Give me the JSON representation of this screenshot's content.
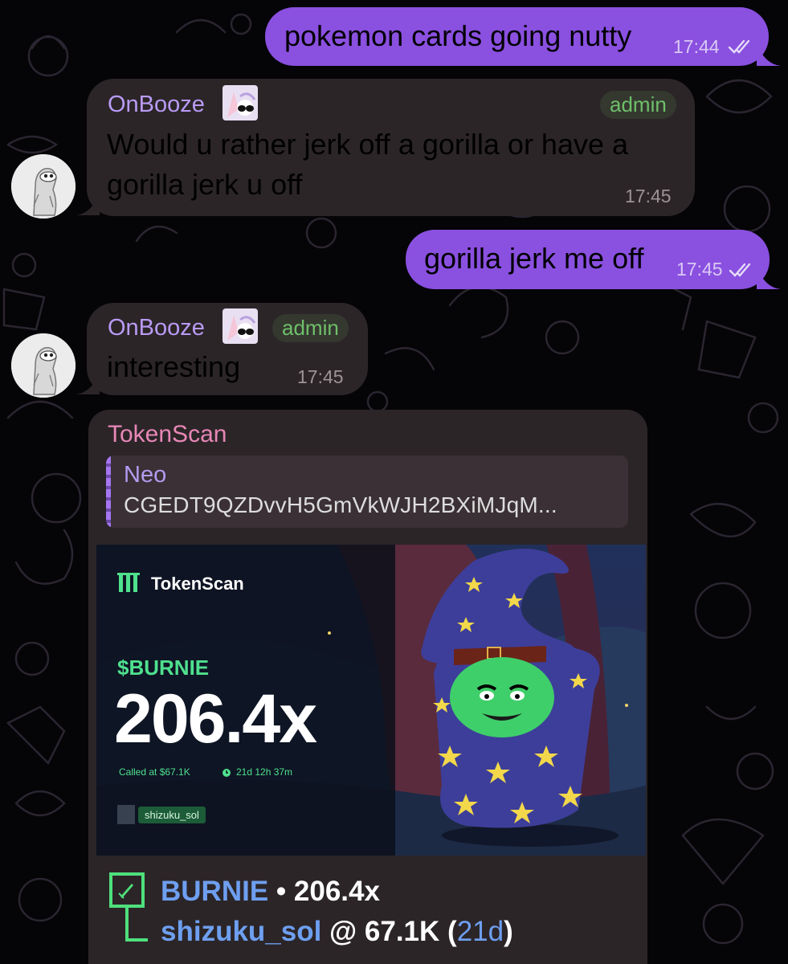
{
  "messages": [
    {
      "type": "out",
      "text": "pokemon cards going nutty",
      "time": "17:44"
    },
    {
      "type": "in",
      "sender": "OnBooze",
      "badge": "admin",
      "line1": "Would u rather jerk off a gorilla or have a",
      "line2": "gorilla jerk u off",
      "time": "17:45"
    },
    {
      "type": "out",
      "text": "gorilla jerk me off",
      "time": "17:45"
    },
    {
      "type": "in",
      "sender": "OnBooze",
      "badge": "admin",
      "text": "interesting",
      "time": "17:45"
    }
  ],
  "token_card": {
    "bot_name": "TokenScan",
    "reply_name": "Neo",
    "reply_text": "CGEDT9QZDvvH5GmVkWJH2BXiMJqM...",
    "preview": {
      "logo_text": "TokenScan",
      "ticker": "$BURNIE",
      "multiplier": "206.4x",
      "called_at": "Called at $67.1K",
      "duration": "21d 12h 37m",
      "username": "shizuku_sol"
    },
    "footer": {
      "token": "BURNIE",
      "sep": " • ",
      "multiplier": "206.4x",
      "user": "shizuku_sol",
      "at": " @ 67.1K (",
      "days": "21d",
      "close": ")"
    }
  },
  "colors": {
    "outgoing_bubble": "#8a50e0",
    "incoming_bubble": "#2b2528",
    "sender_name": "#b99bf5",
    "admin_badge": "#6fbf6a",
    "bot_name": "#e887b6",
    "link": "#6e9ff0",
    "ticker_green": "#4fe08e"
  },
  "icons": [
    "double-check-icon",
    "rocket-icon",
    "clock-icon",
    "tokenscan-logo-icon"
  ]
}
